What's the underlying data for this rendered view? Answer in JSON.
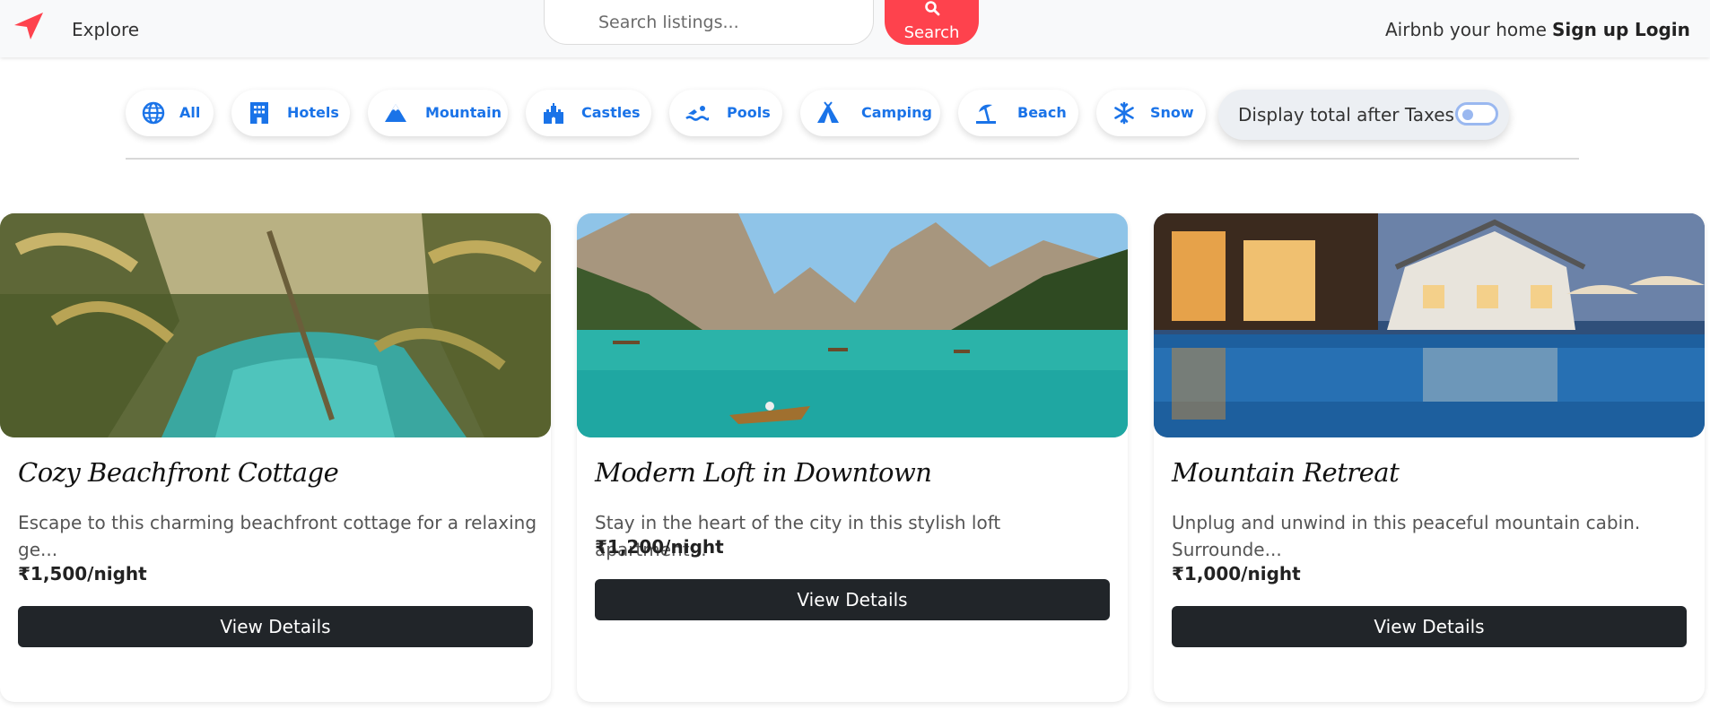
{
  "navbar": {
    "logo_icon": "compass-arrow-icon",
    "explore_label": "Explore",
    "search": {
      "placeholder": "Search listings...",
      "button_label": "Search",
      "button_icon": "search-icon"
    },
    "host_label": "Airbnb your home",
    "signup_label": "Sign up",
    "login_label": "Login",
    "accent_color": "#fe424d"
  },
  "filters": {
    "items": [
      {
        "label": "All",
        "icon": "globe-icon"
      },
      {
        "label": "Hotels",
        "icon": "hotel-icon"
      },
      {
        "label": "Mountain",
        "icon": "mountain-icon"
      },
      {
        "label": "Castles",
        "icon": "castle-icon"
      },
      {
        "label": "Pools",
        "icon": "swimmer-icon"
      },
      {
        "label": "Camping",
        "icon": "tent-icon"
      },
      {
        "label": "Beach",
        "icon": "umbrella-beach-icon"
      },
      {
        "label": "Snow",
        "icon": "snowflake-icon"
      }
    ],
    "tax_toggle_label": "Display total after Taxes",
    "tax_toggle_on": false,
    "filter_color": "#1a73e8"
  },
  "listings": [
    {
      "title": "Cozy Beachfront Cottage",
      "description": "Escape to this charming beachfront cottage for a relaxing ge...",
      "price": "₹1,500/night",
      "button_label": "View Details"
    },
    {
      "title": "Modern Loft in Downtown",
      "description": "Stay in the heart of the city in this stylish loft apartment...",
      "price": "₹1,200/night",
      "button_label": "View Details"
    },
    {
      "title": "Mountain Retreat",
      "description": "Unplug and unwind in this peaceful mountain cabin. Surrounde...",
      "price": "₹1,000/night",
      "button_label": "View Details"
    }
  ]
}
